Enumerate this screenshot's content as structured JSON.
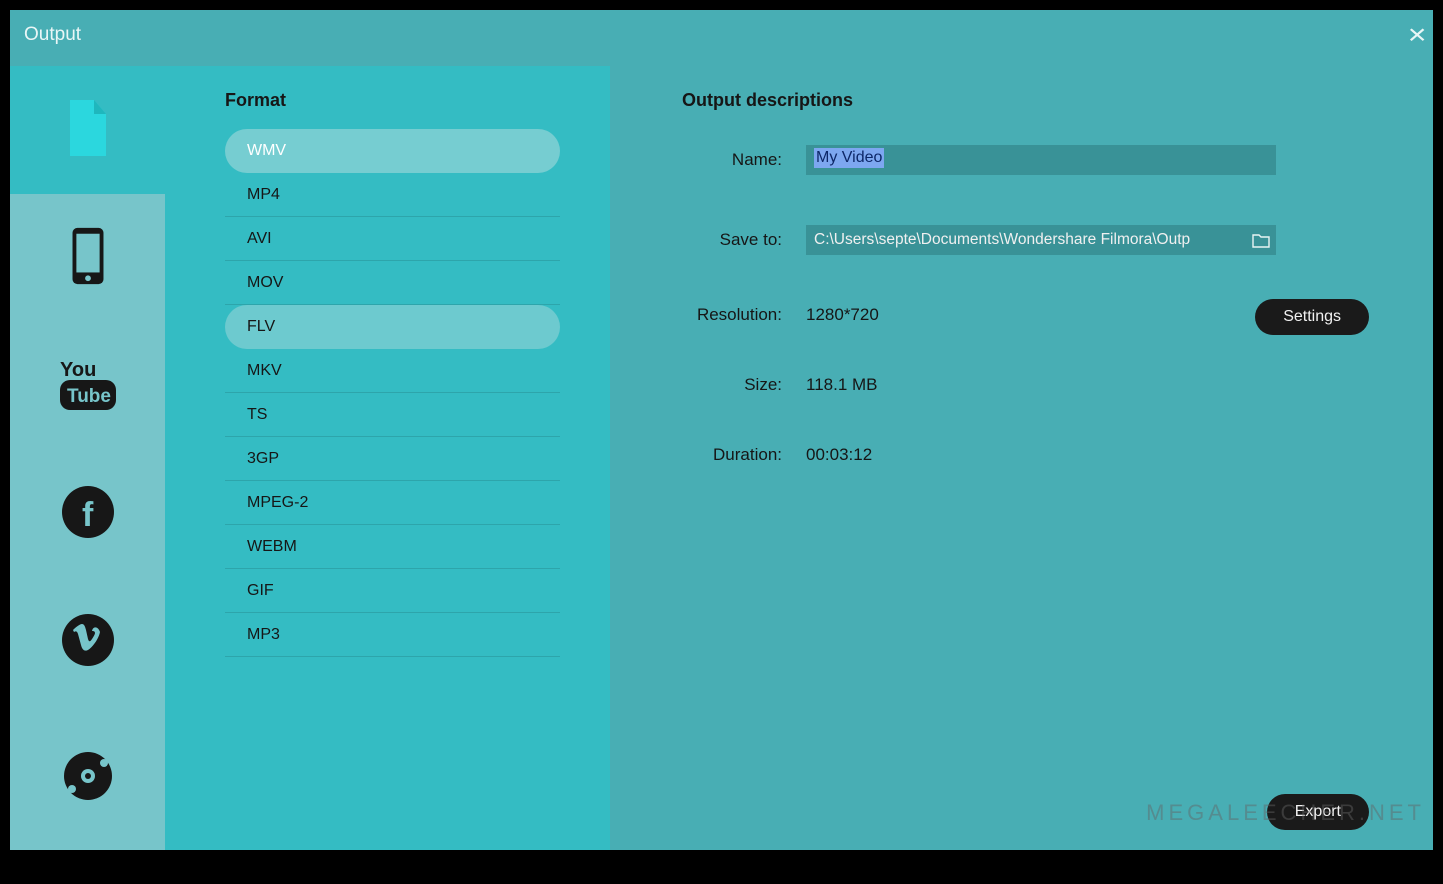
{
  "window": {
    "title": "Output"
  },
  "sidebar": {
    "items": [
      {
        "id": "format",
        "icon": "file-icon",
        "active": true
      },
      {
        "id": "device",
        "icon": "phone-icon",
        "active": false
      },
      {
        "id": "youtube",
        "icon": "youtube-icon",
        "active": false
      },
      {
        "id": "facebook",
        "icon": "facebook-icon",
        "active": false
      },
      {
        "id": "vimeo",
        "icon": "vimeo-icon",
        "active": false
      },
      {
        "id": "dvd",
        "icon": "disc-icon",
        "active": false
      }
    ]
  },
  "format_panel": {
    "title": "Format",
    "items": [
      "WMV",
      "MP4",
      "AVI",
      "MOV",
      "FLV",
      "MKV",
      "TS",
      "3GP",
      "MPEG-2",
      "WEBM",
      "GIF",
      "MP3"
    ],
    "selected": "WMV",
    "hover": "FLV"
  },
  "details": {
    "title": "Output descriptions",
    "labels": {
      "name": "Name:",
      "save": "Save to:",
      "resolution": "Resolution:",
      "size": "Size:",
      "duration": "Duration:"
    },
    "name_value": "My Video",
    "save_path": "C:\\Users\\septe\\Documents\\Wondershare Filmora\\Outp",
    "resolution": "1280*720",
    "size": "118.1 MB",
    "duration": "00:03:12",
    "settings_button": "Settings",
    "export_button": "Export"
  },
  "watermark": "MEGALEECHER.NET"
}
